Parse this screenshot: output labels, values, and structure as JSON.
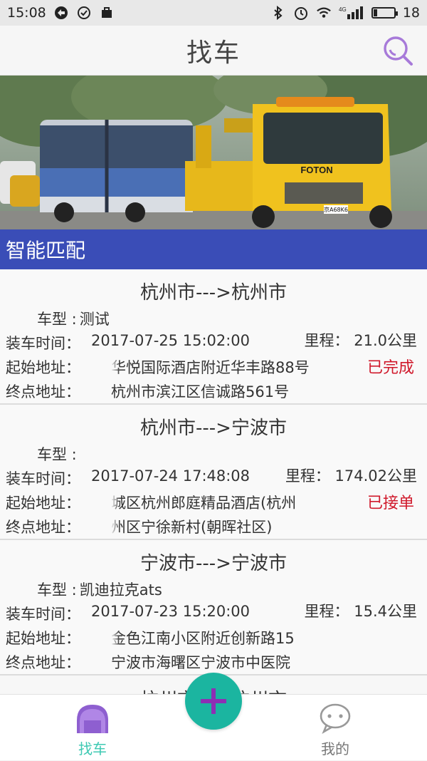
{
  "status_bar": {
    "time": "15:08",
    "network": "4G",
    "battery": "18",
    "battery_level": 0.18
  },
  "app_bar": {
    "title": "找车",
    "search_icon": "search-icon",
    "accent_color": "#a77ad9"
  },
  "banner": {
    "truck_brand": "FOTON",
    "plate": "京A68K6"
  },
  "section": {
    "title": "智能匹配",
    "color": "#3a4db7"
  },
  "labels": {
    "car_type": "车型",
    "load_time": "装车时间",
    "start_addr": "起始地址",
    "end_addr": "终点地址",
    "mileage": "里程"
  },
  "orders": [
    {
      "route": "杭州市--->杭州市",
      "car_type": "测试",
      "load_time": "2017-07-25 15:02:00",
      "mileage": "21.0公里",
      "start_addr": "华悦国际酒店附近华丰路88号",
      "end_addr": "杭州市滨江区信诚路561号",
      "status": "已完成"
    },
    {
      "route": "杭州市--->宁波市",
      "car_type": "",
      "load_time": "2017-07-24 17:48:08",
      "mileage": "174.02公里",
      "start_addr": "城区杭州郎庭精品酒店(杭州",
      "end_addr": "州区宁徐新村(朝晖社区)",
      "status": "已接单"
    },
    {
      "route": "宁波市--->宁波市",
      "car_type": "凯迪拉克ats",
      "load_time": "2017-07-23 15:20:00",
      "mileage": "15.4公里",
      "start_addr": "金色江南小区附近创新路15",
      "end_addr": "宁波市海曙区宁波市中医院",
      "status": ""
    }
  ],
  "partial_next": "杭州市--->杭州市",
  "tab_bar": {
    "find": "找车",
    "mine": "我的",
    "active_color": "#3ec9b3",
    "fab_color": "#1bb5a0"
  }
}
